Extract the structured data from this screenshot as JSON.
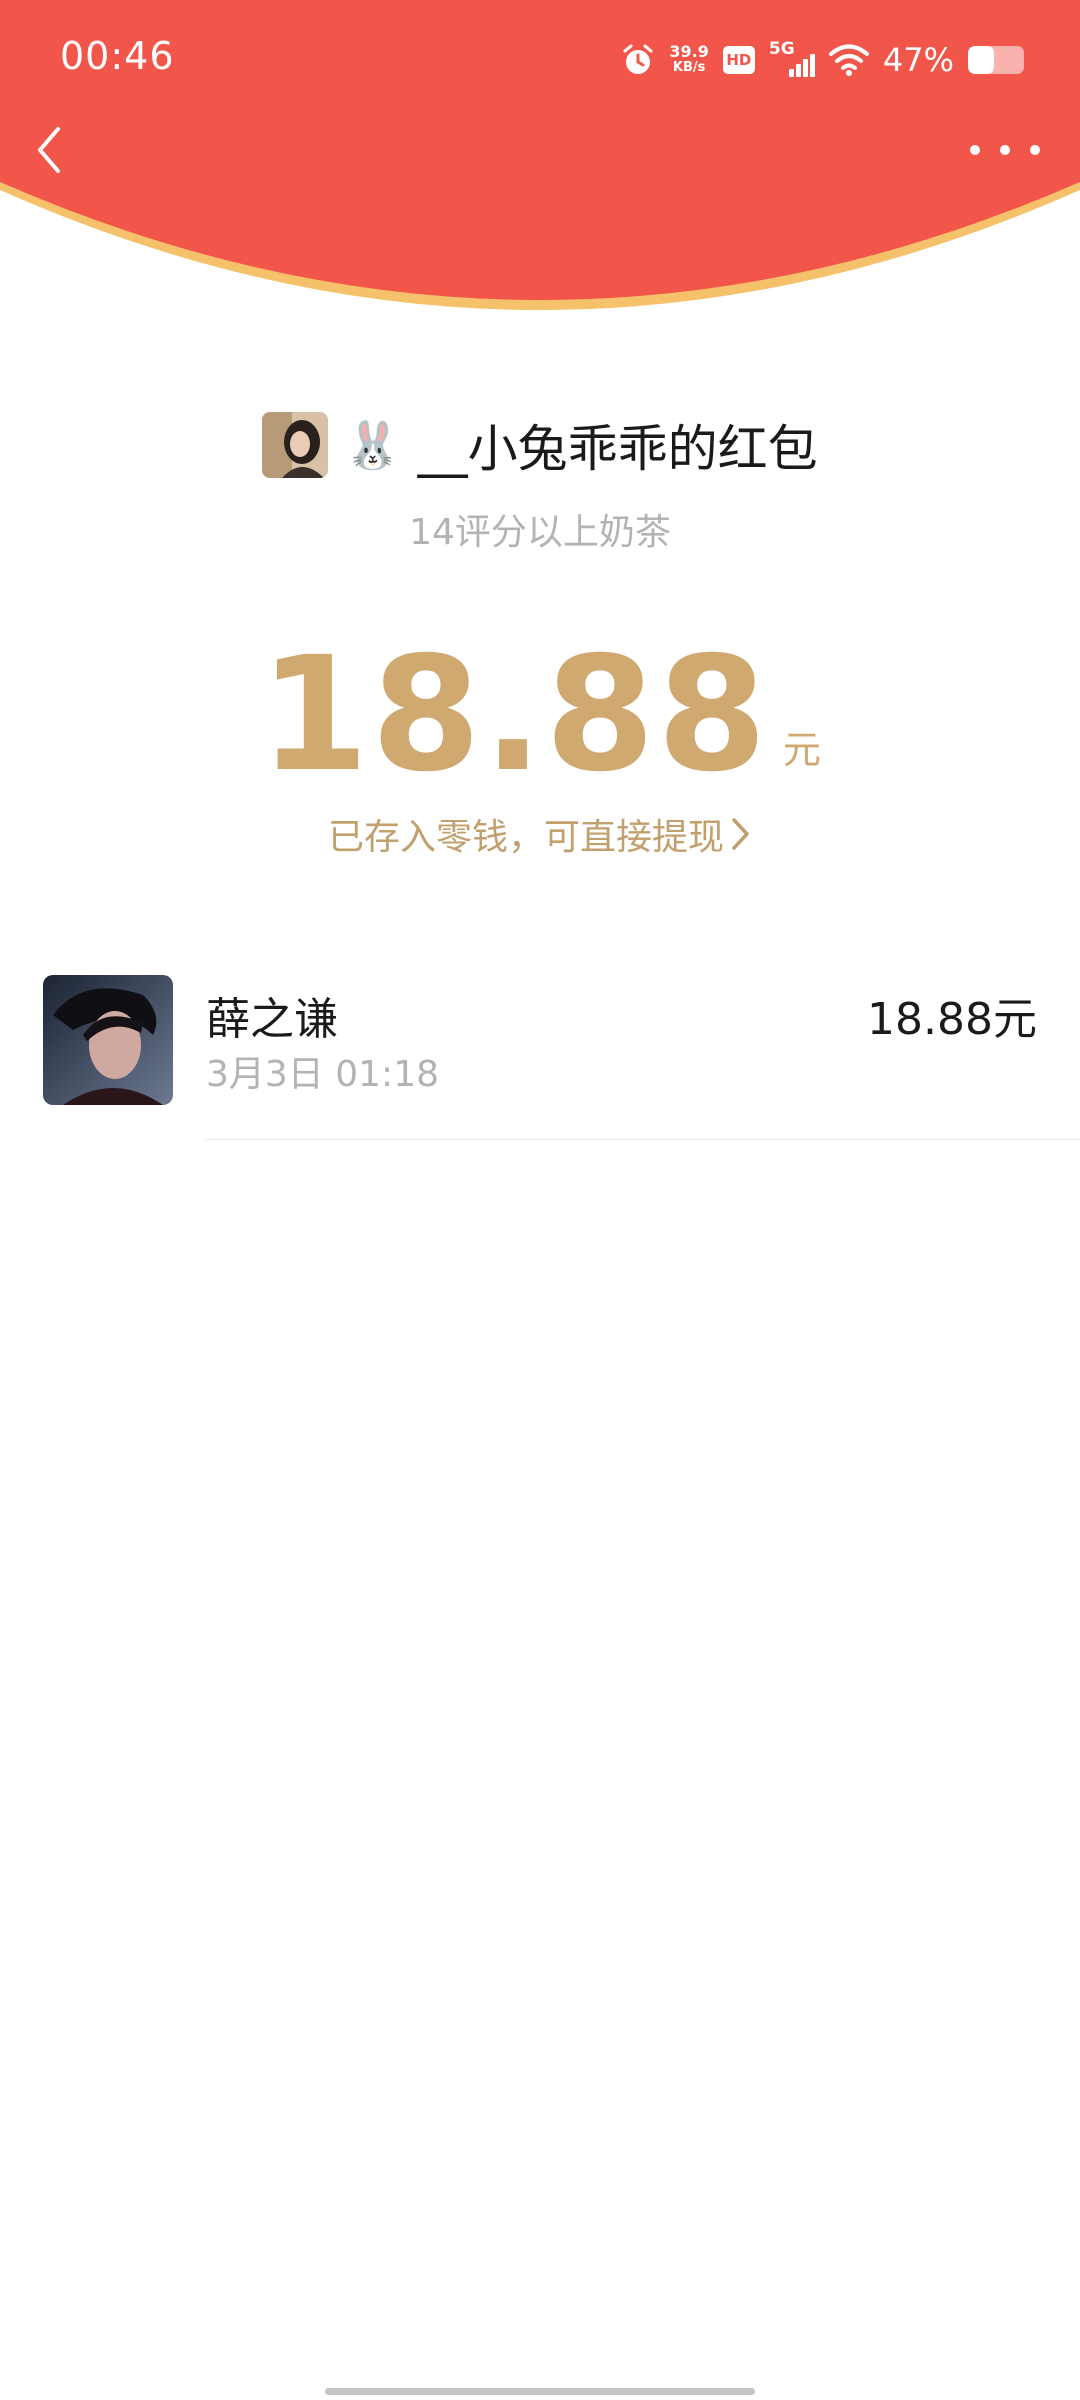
{
  "status_bar": {
    "time": "00:46",
    "net_speed_value": "39.9",
    "net_speed_unit": "KB/s",
    "hd_label": "HD",
    "network_label": "5G",
    "battery_percent_label": "47%",
    "battery_level": 0.47
  },
  "nav": {
    "back_icon": "chevron-left-icon",
    "more_icon": "more-dots-icon"
  },
  "colors": {
    "header_red": "#F2564A",
    "header_rim": "#F5C26B",
    "gold": "#CFA970"
  },
  "sender": {
    "emoji": "🐰",
    "name_text": "__小兔乖乖的红包",
    "blessing": "14评分以上奶茶"
  },
  "amount": {
    "value": "18.88",
    "unit": "元"
  },
  "deposit_link": {
    "label": "已存入零钱，可直接提现"
  },
  "receivers": [
    {
      "name": "薛之谦",
      "time": "3月3日  01:18",
      "amount": "18.88元"
    }
  ]
}
